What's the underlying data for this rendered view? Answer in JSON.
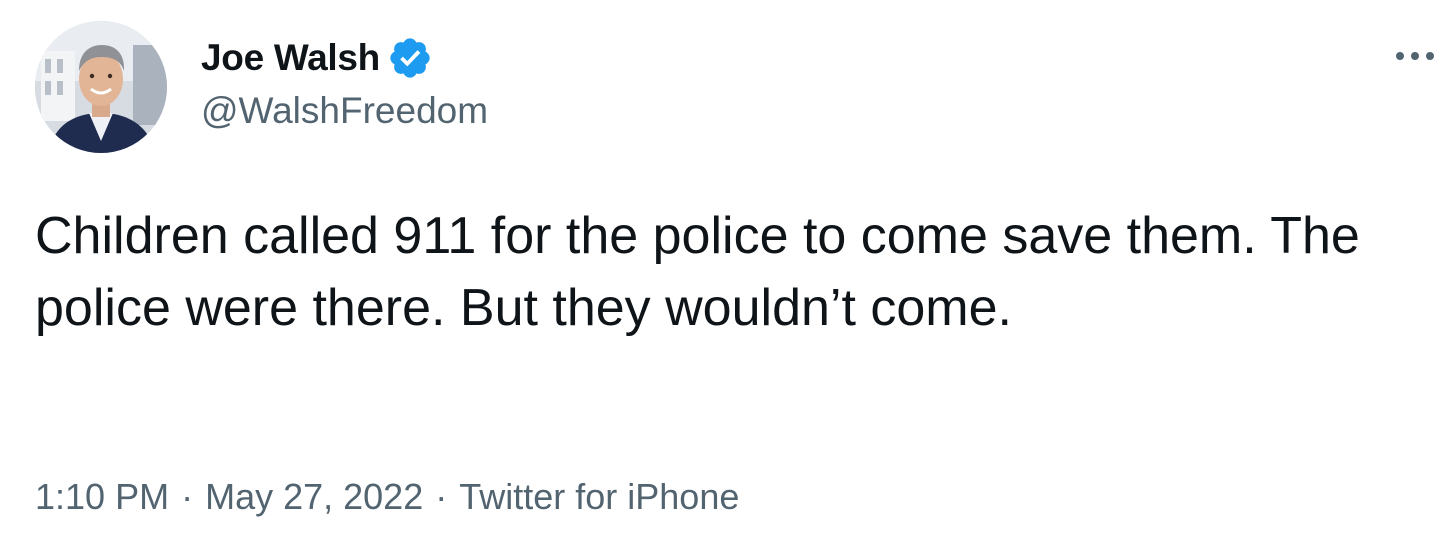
{
  "tweet": {
    "author": {
      "display_name": "Joe Walsh",
      "handle": "@WalshFreedom",
      "verified": true,
      "avatar_icon": "profile-photo"
    },
    "text": "Children called 911 for the police to come save them. The police were there. But they wouldn’t come.",
    "time": "1:10 PM",
    "date": "May 27, 2022",
    "source": "Twitter for iPhone",
    "separator": "·",
    "more_icon": "more-options-icon"
  },
  "colors": {
    "text_primary": "#0f1419",
    "text_secondary": "#536471",
    "verified_badge": "#1d9bf0",
    "background": "#ffffff"
  }
}
